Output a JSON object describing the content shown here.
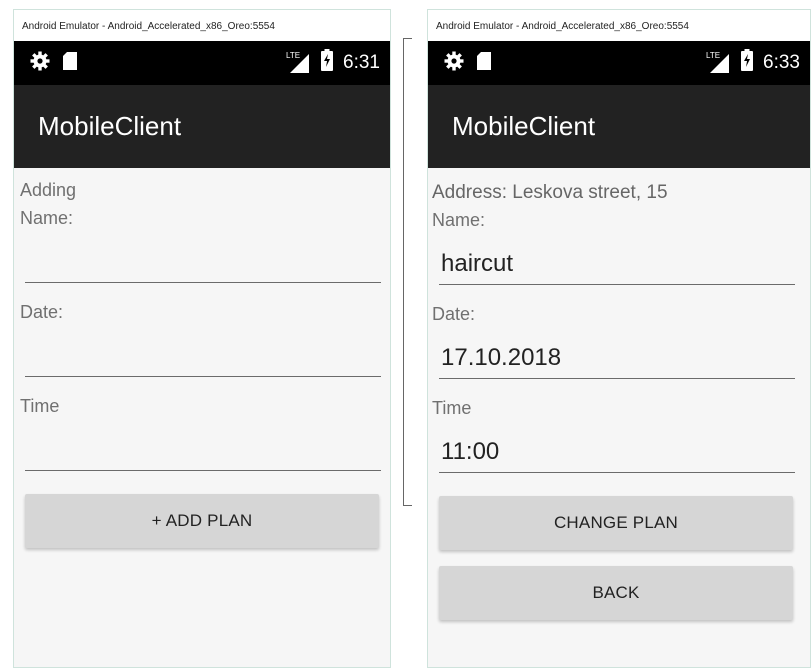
{
  "left": {
    "window_title": "Android Emulator - Android_Accelerated_x86_Oreo:5554",
    "status": {
      "icons": [
        "gear-icon",
        "sd-card-icon",
        "lte-signal-icon",
        "battery-icon"
      ],
      "lte": "LTE",
      "time": "6:31"
    },
    "app_title": "MobileClient",
    "header_text": "Adding",
    "name_label": "Name:",
    "name_value": "",
    "date_label": "Date:",
    "date_value": "",
    "time_label": "Time",
    "time_value": "",
    "add_button": "+ ADD PLAN"
  },
  "right": {
    "window_title": "Android Emulator - Android_Accelerated_x86_Oreo:5554",
    "status": {
      "icons": [
        "gear-icon",
        "sd-card-icon",
        "lte-signal-icon",
        "battery-icon"
      ],
      "lte": "LTE",
      "time": "6:33"
    },
    "app_title": "MobileClient",
    "address_text": "Address: Leskova street, 15",
    "name_label": "Name:",
    "name_value": "haircut",
    "date_label": "Date:",
    "date_value": "17.10.2018",
    "time_label": "Time",
    "time_value": "11:00",
    "change_button": "CHANGE PLAN",
    "back_button": "BACK"
  },
  "colors": {
    "status_bar": "#000000",
    "app_bar": "#222222",
    "content_bg": "#f6f6f6",
    "button_bg": "#d6d6d6"
  }
}
